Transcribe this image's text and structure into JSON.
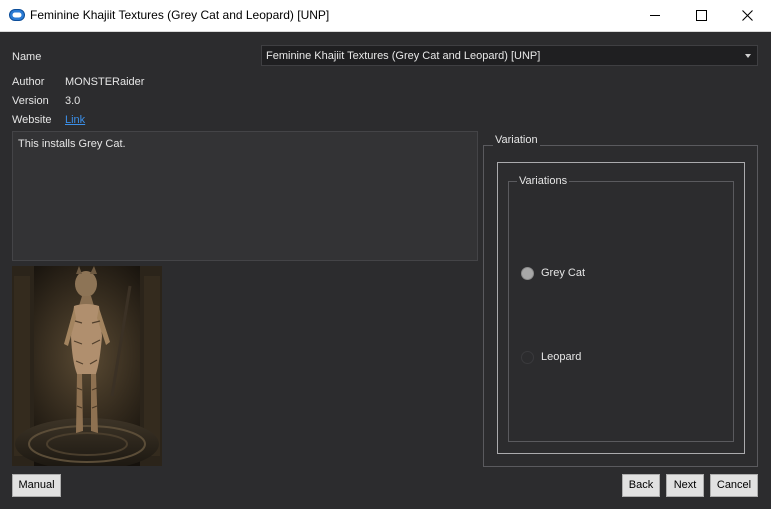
{
  "window": {
    "title": "Feminine Khajiit Textures (Grey Cat and Leopard) [UNP]",
    "minimize_icon": "minimize-icon",
    "maximize_icon": "maximize-icon",
    "close_icon": "close-icon"
  },
  "info": {
    "name_label": "Name",
    "name_value": "Feminine Khajiit Textures (Grey Cat and Leopard) [UNP]",
    "author_label": "Author",
    "author_value": "MONSTERaider",
    "version_label": "Version",
    "version_value": "3.0",
    "website_label": "Website",
    "website_link": "Link"
  },
  "description": "This installs Grey Cat.",
  "preview_image": "preview-image",
  "variation": {
    "title": "Variation",
    "group_title": "Variations",
    "options": [
      {
        "label": "Grey Cat",
        "selected": true
      },
      {
        "label": "Leopard",
        "selected": false
      }
    ]
  },
  "buttons": {
    "manual": "Manual",
    "back": "Back",
    "next": "Next",
    "cancel": "Cancel"
  },
  "colors": {
    "background": "#2c2c2e",
    "link": "#3b8fe8",
    "button": "#e1e1e1"
  }
}
